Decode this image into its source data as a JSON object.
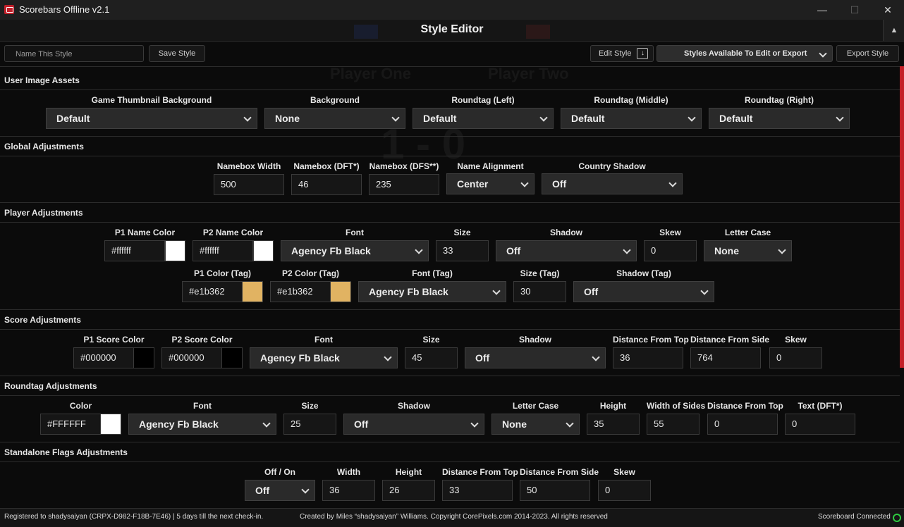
{
  "window": {
    "title": "Scorebars Offline v2.1",
    "minimize": "—",
    "maximize": "☐",
    "close": "✕"
  },
  "header": {
    "title": "Style Editor",
    "collapse": "▲"
  },
  "toolbar": {
    "name_placeholder": "Name This Style",
    "save_label": "Save Style",
    "edit_label": "Edit Style",
    "styles_select": "Styles Available To Edit or Export",
    "export_label": "Export Style"
  },
  "background_text": {
    "p1": "Player One",
    "p2": "Player Two",
    "score": "1 - 0"
  },
  "user_image_assets": {
    "title": "User Image Assets",
    "fields": [
      {
        "label": "Game Thumbnail Background",
        "value": "Default"
      },
      {
        "label": "Background",
        "value": "None"
      },
      {
        "label": "Roundtag (Left)",
        "value": "Default"
      },
      {
        "label": "Roundtag (Middle)",
        "value": "Default"
      },
      {
        "label": "Roundtag (Right)",
        "value": "Default"
      }
    ]
  },
  "global_adjustments": {
    "title": "Global Adjustments",
    "namebox_width": {
      "label": "Namebox Width",
      "value": "500"
    },
    "namebox_dft": {
      "label": "Namebox (DFT*)",
      "value": "46"
    },
    "namebox_dfs": {
      "label": "Namebox (DFS**)",
      "value": "235"
    },
    "name_alignment": {
      "label": "Name Alignment",
      "value": "Center"
    },
    "country_shadow": {
      "label": "Country Shadow",
      "value": "Off"
    }
  },
  "player_adjustments": {
    "title": "Player Adjustments",
    "p1_name_color": {
      "label": "P1 Name Color",
      "value": "#ffffff",
      "swatch": "#ffffff"
    },
    "p2_name_color": {
      "label": "P2 Name Color",
      "value": "#ffffff",
      "swatch": "#ffffff"
    },
    "font": {
      "label": "Font",
      "value": "Agency Fb Black"
    },
    "size": {
      "label": "Size",
      "value": "33"
    },
    "shadow": {
      "label": "Shadow",
      "value": "Off"
    },
    "skew": {
      "label": "Skew",
      "value": "0"
    },
    "letter_case": {
      "label": "Letter Case",
      "value": "None"
    },
    "p1_color_tag": {
      "label": "P1 Color (Tag)",
      "value": "#e1b362",
      "swatch": "#e1b362"
    },
    "p2_color_tag": {
      "label": "P2 Color (Tag)",
      "value": "#e1b362",
      "swatch": "#e1b362"
    },
    "font_tag": {
      "label": "Font (Tag)",
      "value": "Agency Fb Black"
    },
    "size_tag": {
      "label": "Size (Tag)",
      "value": "30"
    },
    "shadow_tag": {
      "label": "Shadow (Tag)",
      "value": "Off"
    }
  },
  "score_adjustments": {
    "title": "Score Adjustments",
    "p1_score_color": {
      "label": "P1 Score Color",
      "value": "#000000",
      "swatch": "#000000"
    },
    "p2_score_color": {
      "label": "P2 Score Color",
      "value": "#000000",
      "swatch": "#000000"
    },
    "font": {
      "label": "Font",
      "value": "Agency Fb Black"
    },
    "size": {
      "label": "Size",
      "value": "45"
    },
    "shadow": {
      "label": "Shadow",
      "value": "Off"
    },
    "distance_top": {
      "label": "Distance From Top",
      "value": "36"
    },
    "distance_side": {
      "label": "Distance From Side",
      "value": "764"
    },
    "skew": {
      "label": "Skew",
      "value": "0"
    }
  },
  "roundtag_adjustments": {
    "title": "Roundtag Adjustments",
    "color": {
      "label": "Color",
      "value": "#FFFFFF",
      "swatch": "#ffffff"
    },
    "font": {
      "label": "Font",
      "value": "Agency Fb Black"
    },
    "size": {
      "label": "Size",
      "value": "25"
    },
    "shadow": {
      "label": "Shadow",
      "value": "Off"
    },
    "letter_case": {
      "label": "Letter Case",
      "value": "None"
    },
    "height": {
      "label": "Height",
      "value": "35"
    },
    "width_sides": {
      "label": "Width of Sides",
      "value": "55"
    },
    "distance_top": {
      "label": "Distance From Top",
      "value": "0"
    },
    "text_dft": {
      "label": "Text (DFT*)",
      "value": "0"
    }
  },
  "standalone_flags": {
    "title": "Standalone Flags Adjustments",
    "off_on": {
      "label": "Off / On",
      "value": "Off"
    },
    "width": {
      "label": "Width",
      "value": "36"
    },
    "height": {
      "label": "Height",
      "value": "26"
    },
    "distance_top": {
      "label": "Distance From Top",
      "value": "33"
    },
    "distance_side": {
      "label": "Distance From Side",
      "value": "50"
    },
    "skew": {
      "label": "Skew",
      "value": "0"
    }
  },
  "status": {
    "registration": "Registered to shadysaiyan (CRPX-D982-F18B-7E46) | 5 days till the next check-in.",
    "credits": "Created by Miles “shadysaiyan” Williams. Copyright CorePixels.com 2014-2023. All rights reserved",
    "connection": "Scoreboard Connected",
    "connected_color": "#2ecc40"
  }
}
